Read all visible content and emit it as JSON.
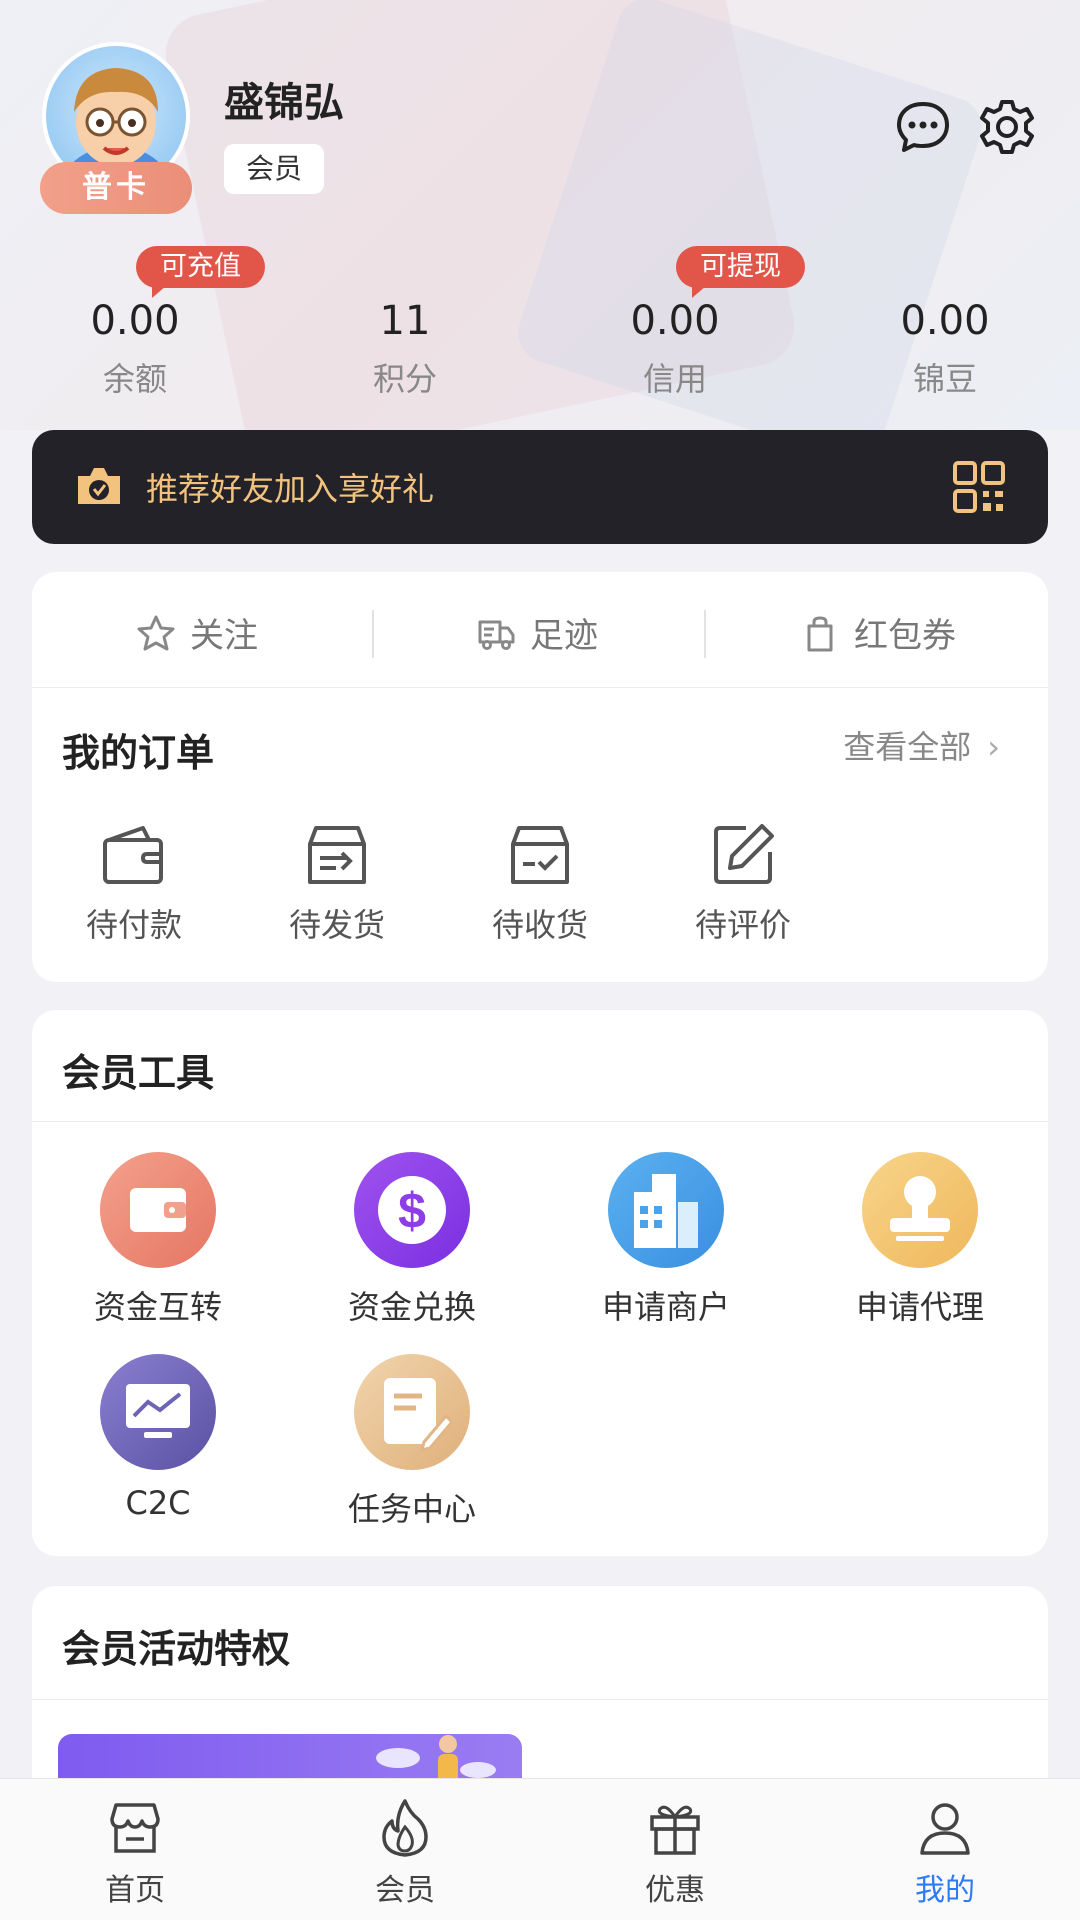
{
  "profile": {
    "name": "盛锦弘",
    "member_tag": "会员",
    "card_level": "普卡"
  },
  "stats": [
    {
      "value": "0.00",
      "label": "余额",
      "bubble": "可充值"
    },
    {
      "value": "11",
      "label": "积分",
      "bubble": ""
    },
    {
      "value": "0.00",
      "label": "信用",
      "bubble": "可提现"
    },
    {
      "value": "0.00",
      "label": "锦豆",
      "bubble": ""
    }
  ],
  "invite": {
    "text": "推荐好友加入享好礼"
  },
  "quick_links": [
    {
      "label": "关注",
      "icon": "star-icon"
    },
    {
      "label": "足迹",
      "icon": "footprint-truck-icon"
    },
    {
      "label": "红包券",
      "icon": "bag-icon"
    }
  ],
  "orders": {
    "title": "我的订单",
    "view_all": "查看全部",
    "items": [
      {
        "label": "待付款",
        "icon": "wallet-icon"
      },
      {
        "label": "待发货",
        "icon": "box-out-icon"
      },
      {
        "label": "待收货",
        "icon": "box-check-icon"
      },
      {
        "label": "待评价",
        "icon": "edit-icon"
      }
    ]
  },
  "tools": {
    "title": "会员工具",
    "items": [
      {
        "label": "资金互转",
        "icon": "wallet-transfer-icon",
        "color": "#ec8a74"
      },
      {
        "label": "资金兑换",
        "icon": "dollar-icon",
        "color": "#8f3ee6"
      },
      {
        "label": "申请商户",
        "icon": "building-icon",
        "color": "#4aa3ea"
      },
      {
        "label": "申请代理",
        "icon": "stamp-icon",
        "color": "#f2c46d"
      },
      {
        "label": "C2C",
        "icon": "chart-monitor-icon",
        "color": "#6e64b4"
      },
      {
        "label": "任务中心",
        "icon": "task-note-icon",
        "color": "#e9c08f"
      }
    ]
  },
  "activity": {
    "title": "会员活动特权"
  },
  "tabbar": [
    {
      "label": "首页",
      "icon": "store-icon",
      "active": false
    },
    {
      "label": "会员",
      "icon": "flame-icon",
      "active": false
    },
    {
      "label": "优惠",
      "icon": "gift-icon",
      "active": false
    },
    {
      "label": "我的",
      "icon": "user-icon",
      "active": true
    }
  ],
  "colors": {
    "accent": "#2f7bf3",
    "bubble": "#e2564a",
    "invite_text": "#f2c27f",
    "invite_bg": "#242229"
  }
}
